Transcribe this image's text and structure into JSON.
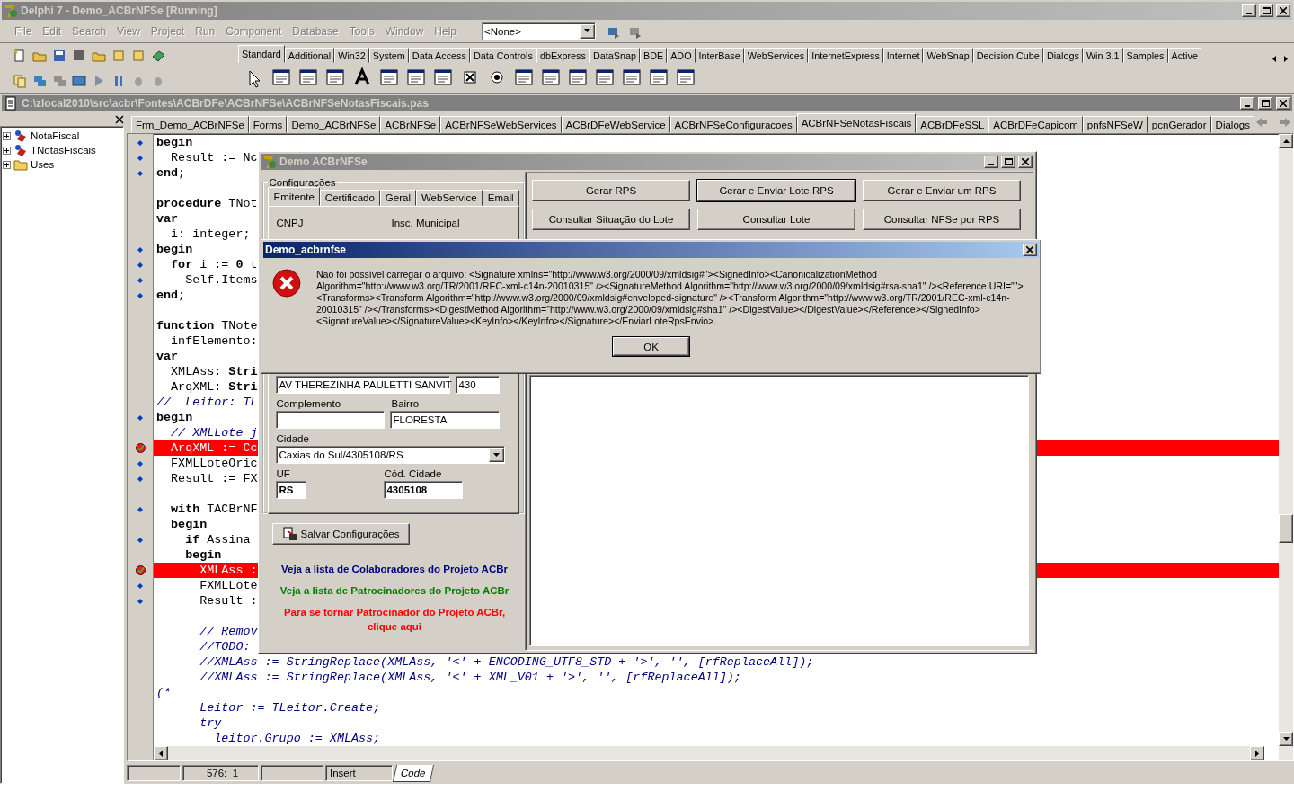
{
  "ide": {
    "title": "Delphi 7 - Demo_ACBrNFSe [Running]",
    "menu": [
      {
        "label": "File",
        "disabled": true
      },
      {
        "label": "Edit",
        "disabled": true
      },
      {
        "label": "Search",
        "disabled": true
      },
      {
        "label": "View",
        "disabled": true
      },
      {
        "label": "Project",
        "disabled": true
      },
      {
        "label": "Run",
        "disabled": true
      },
      {
        "label": "Component",
        "disabled": true
      },
      {
        "label": "Database",
        "disabled": true
      },
      {
        "label": "Tools",
        "disabled": true
      },
      {
        "label": "Window",
        "disabled": true
      },
      {
        "label": "Help",
        "disabled": true
      }
    ],
    "desktop_combo": "<None>",
    "palette_tabs": [
      {
        "label": "Standard",
        "selected": true
      },
      {
        "label": "Additional",
        "selected": false
      },
      {
        "label": "Win32",
        "selected": false
      },
      {
        "label": "System",
        "selected": false
      },
      {
        "label": "Data Access",
        "selected": false
      },
      {
        "label": "Data Controls",
        "selected": false
      },
      {
        "label": "dbExpress",
        "selected": false
      },
      {
        "label": "DataSnap",
        "selected": false
      },
      {
        "label": "BDE",
        "selected": false
      },
      {
        "label": "ADO",
        "selected": false
      },
      {
        "label": "InterBase",
        "selected": false
      },
      {
        "label": "WebServices",
        "selected": false
      },
      {
        "label": "InternetExpress",
        "selected": false
      },
      {
        "label": "Internet",
        "selected": false
      },
      {
        "label": "WebSnap",
        "selected": false
      },
      {
        "label": "Decision Cube",
        "selected": false
      },
      {
        "label": "Dialogs",
        "selected": false
      },
      {
        "label": "Win 3.1",
        "selected": false
      },
      {
        "label": "Samples",
        "selected": false
      },
      {
        "label": "Active",
        "selected": false
      }
    ]
  },
  "editor": {
    "path": "C:\\zlocal2010\\src\\acbr\\Fontes\\ACBrDFe\\ACBrNFSe\\ACBrNFSeNotasFiscais.pas",
    "tree": [
      {
        "label": "NotaFiscal",
        "kind": "class"
      },
      {
        "label": "TNotasFiscais",
        "kind": "class"
      },
      {
        "label": "Uses",
        "kind": "folder"
      }
    ],
    "tabs": [
      {
        "label": "Frm_Demo_ACBrNFSe",
        "selected": false
      },
      {
        "label": "Forms",
        "selected": false
      },
      {
        "label": "Demo_ACBrNFSe",
        "selected": false
      },
      {
        "label": "ACBrNFSe",
        "selected": false
      },
      {
        "label": "ACBrNFSeWebServices",
        "selected": false
      },
      {
        "label": "ACBrDFeWebService",
        "selected": false
      },
      {
        "label": "ACBrNFSeConfiguracoes",
        "selected": false
      },
      {
        "label": "ACBrNFSeNotasFiscais",
        "selected": true
      },
      {
        "label": "ACBrDFeSSL",
        "selected": false
      },
      {
        "label": "ACBrDFeCapicom",
        "selected": false
      },
      {
        "label": "pnfsNFSeW",
        "selected": false
      },
      {
        "label": "pcnGerador",
        "selected": false
      },
      {
        "label": "Dialogs",
        "selected": false
      }
    ],
    "lines": [
      {
        "text": "**begin**",
        "executable": true,
        "breakpoint": false,
        "kind": "code"
      },
      {
        "text": "  Result := Nc",
        "executable": true,
        "breakpoint": false,
        "kind": "code"
      },
      {
        "text": "**end**;",
        "executable": true,
        "breakpoint": false,
        "kind": "code"
      },
      {
        "executable": false,
        "breakpoint": false,
        "kind": "code"
      },
      {
        "text": "**procedure** TNot",
        "executable": false,
        "breakpoint": false,
        "kind": "code"
      },
      {
        "text": "**var**",
        "executable": false,
        "breakpoint": false,
        "kind": "code"
      },
      {
        "text": "  i: integer;",
        "executable": false,
        "breakpoint": false,
        "kind": "code"
      },
      {
        "text": "**begin**",
        "executable": true,
        "breakpoint": false,
        "kind": "code"
      },
      {
        "text": "  **for** i := **0** t",
        "executable": true,
        "breakpoint": false,
        "kind": "code"
      },
      {
        "text": "    Self.Items",
        "executable": true,
        "breakpoint": false,
        "kind": "code"
      },
      {
        "text": "**end**;",
        "executable": true,
        "breakpoint": false,
        "kind": "code"
      },
      {
        "executable": false,
        "breakpoint": false,
        "kind": "code"
      },
      {
        "text": "**function** TNote",
        "executable": false,
        "breakpoint": false,
        "kind": "code"
      },
      {
        "text": "  infElemento:",
        "executable": false,
        "breakpoint": false,
        "kind": "code"
      },
      {
        "text": "**var**",
        "executable": false,
        "breakpoint": false,
        "kind": "code"
      },
      {
        "text": "  XMLAss: **Stri**",
        "executable": false,
        "breakpoint": false,
        "kind": "code"
      },
      {
        "text": "  ArqXML: **Stri**",
        "executable": false,
        "breakpoint": false,
        "kind": "code"
      },
      {
        "text": "//  Leitor: TL",
        "executable": false,
        "breakpoint": false,
        "kind": "comment"
      },
      {
        "text": "**begin**",
        "executable": true,
        "breakpoint": false,
        "kind": "code"
      },
      {
        "text": "  // XMLLote j",
        "executable": false,
        "breakpoint": false,
        "kind": "comment"
      },
      {
        "text": "  ArqXML := Cc",
        "executable": true,
        "breakpoint": true,
        "kind": "code"
      },
      {
        "text": "  FXMLLoteOric",
        "executable": true,
        "breakpoint": false,
        "kind": "code"
      },
      {
        "text": "  Result := FX",
        "executable": true,
        "breakpoint": false,
        "kind": "code"
      },
      {
        "executable": false,
        "breakpoint": false,
        "kind": "code"
      },
      {
        "text": "  **with** TACBrNF",
        "executable": true,
        "breakpoint": false,
        "kind": "code"
      },
      {
        "text": "  **begin**",
        "executable": false,
        "breakpoint": false,
        "kind": "code"
      },
      {
        "text": "    **if** Assina",
        "executable": true,
        "breakpoint": false,
        "kind": "code"
      },
      {
        "text": "    **begin**",
        "executable": false,
        "breakpoint": false,
        "kind": "code"
      },
      {
        "text": "      XMLAss :",
        "executable": true,
        "breakpoint": true,
        "kind": "code"
      },
      {
        "text": "      FXMLLote",
        "executable": true,
        "breakpoint": false,
        "kind": "code"
      },
      {
        "text": "      Result :",
        "executable": true,
        "breakpoint": false,
        "kind": "code"
      },
      {
        "executable": false,
        "breakpoint": false,
        "kind": "code"
      },
      {
        "text": "      // Remov",
        "executable": false,
        "breakpoint": false,
        "kind": "comment"
      },
      {
        "text": "      //TODO:",
        "executable": false,
        "breakpoint": false,
        "kind": "comment"
      },
      {
        "text": "      //XMLAss := StringReplace(XMLAss, '<' + ENCODING_UTF8_STD + '>', '', [rfReplaceAll]);",
        "executable": false,
        "breakpoint": false,
        "kind": "comment"
      },
      {
        "text": "      //XMLAss := StringReplace(XMLAss, '<' + XML_V01 + '>', '', [rfReplaceAll]);",
        "executable": false,
        "breakpoint": false,
        "kind": "comment"
      },
      {
        "text": "(*",
        "executable": false,
        "breakpoint": false,
        "kind": "comment"
      },
      {
        "text": "      Leitor := TLeitor.Create;",
        "executable": false,
        "breakpoint": false,
        "kind": "comment"
      },
      {
        "text": "      try",
        "executable": false,
        "breakpoint": false,
        "kind": "comment"
      },
      {
        "text": "        leitor.Grupo := XMLAss;",
        "executable": false,
        "breakpoint": false,
        "kind": "comment"
      }
    ],
    "status": {
      "position": "576:  1",
      "mode": "Insert",
      "view_tab": "Code"
    }
  },
  "demo_window": {
    "title": "Demo ACBrNFSe",
    "group_title": "Configurações",
    "tabs": [
      {
        "label": "Emitente",
        "selected": true
      },
      {
        "label": "Certificado",
        "selected": false
      },
      {
        "label": "Geral",
        "selected": false
      },
      {
        "label": "WebService",
        "selected": false
      },
      {
        "label": "Email",
        "selected": false
      }
    ],
    "cnpj_label": "CNPJ",
    "im_label": "Insc. Municipal",
    "address_value": "AV THEREZINHA PAULETTI SANVIT",
    "number_value": "430",
    "complement_label": "Complemento",
    "district_label": "Bairro",
    "district_value": "FLORESTA",
    "city_label": "Cidade",
    "city_value": "Caxias do Sul/4305108/RS",
    "uf_label": "UF",
    "uf_value": "RS",
    "city_code_label": "Cód. Cidade",
    "city_code_value": "4305108",
    "save_button": "Salvar Configurações",
    "links": [
      {
        "text": "Veja a lista de Colaboradores do Projeto ACBr",
        "color": "#000080"
      },
      {
        "text": "Veja a lista de Patrocinadores do Projeto ACBr",
        "color": "#008000"
      },
      {
        "text": "Para se tornar Patrocinador do Projeto ACBr, clique aqui",
        "color": "#ff0000"
      }
    ],
    "action_buttons": [
      {
        "label": "Gerar RPS",
        "focused": false
      },
      {
        "label": "Gerar e Enviar Lote RPS",
        "focused": true
      },
      {
        "label": "Gerar e Enviar um RPS",
        "focused": false
      },
      {
        "label": "Consultar Situação do Lote",
        "focused": false
      },
      {
        "label": "Consultar Lote",
        "focused": false
      },
      {
        "label": "Consultar NFSe por RPS",
        "focused": false
      }
    ]
  },
  "dialog": {
    "title": "Demo_acbrnfse",
    "message": "Não foi possível carregar o arquivo: <Signature xmlns=\"http://www.w3.org/2000/09/xmldsig#\"><SignedInfo><CanonicalizationMethod Algorithm=\"http://www.w3.org/TR/2001/REC-xml-c14n-20010315\" /><SignatureMethod Algorithm=\"http://www.w3.org/2000/09/xmldsig#rsa-sha1\" /><Reference URI=\"\"><Transforms><Transform Algorithm=\"http://www.w3.org/2000/09/xmldsig#enveloped-signature\" /><Transform Algorithm=\"http://www.w3.org/TR/2001/REC-xml-c14n-20010315\" /></Transforms><DigestMethod Algorithm=\"http://www.w3.org/2000/09/xmldsig#sha1\" /><DigestValue></DigestValue></Reference></SignedInfo><SignatureValue></SignatureValue><KeyInfo></KeyInfo></Signature></EnviarLoteRpsEnvio>.",
    "ok_button": "OK"
  }
}
